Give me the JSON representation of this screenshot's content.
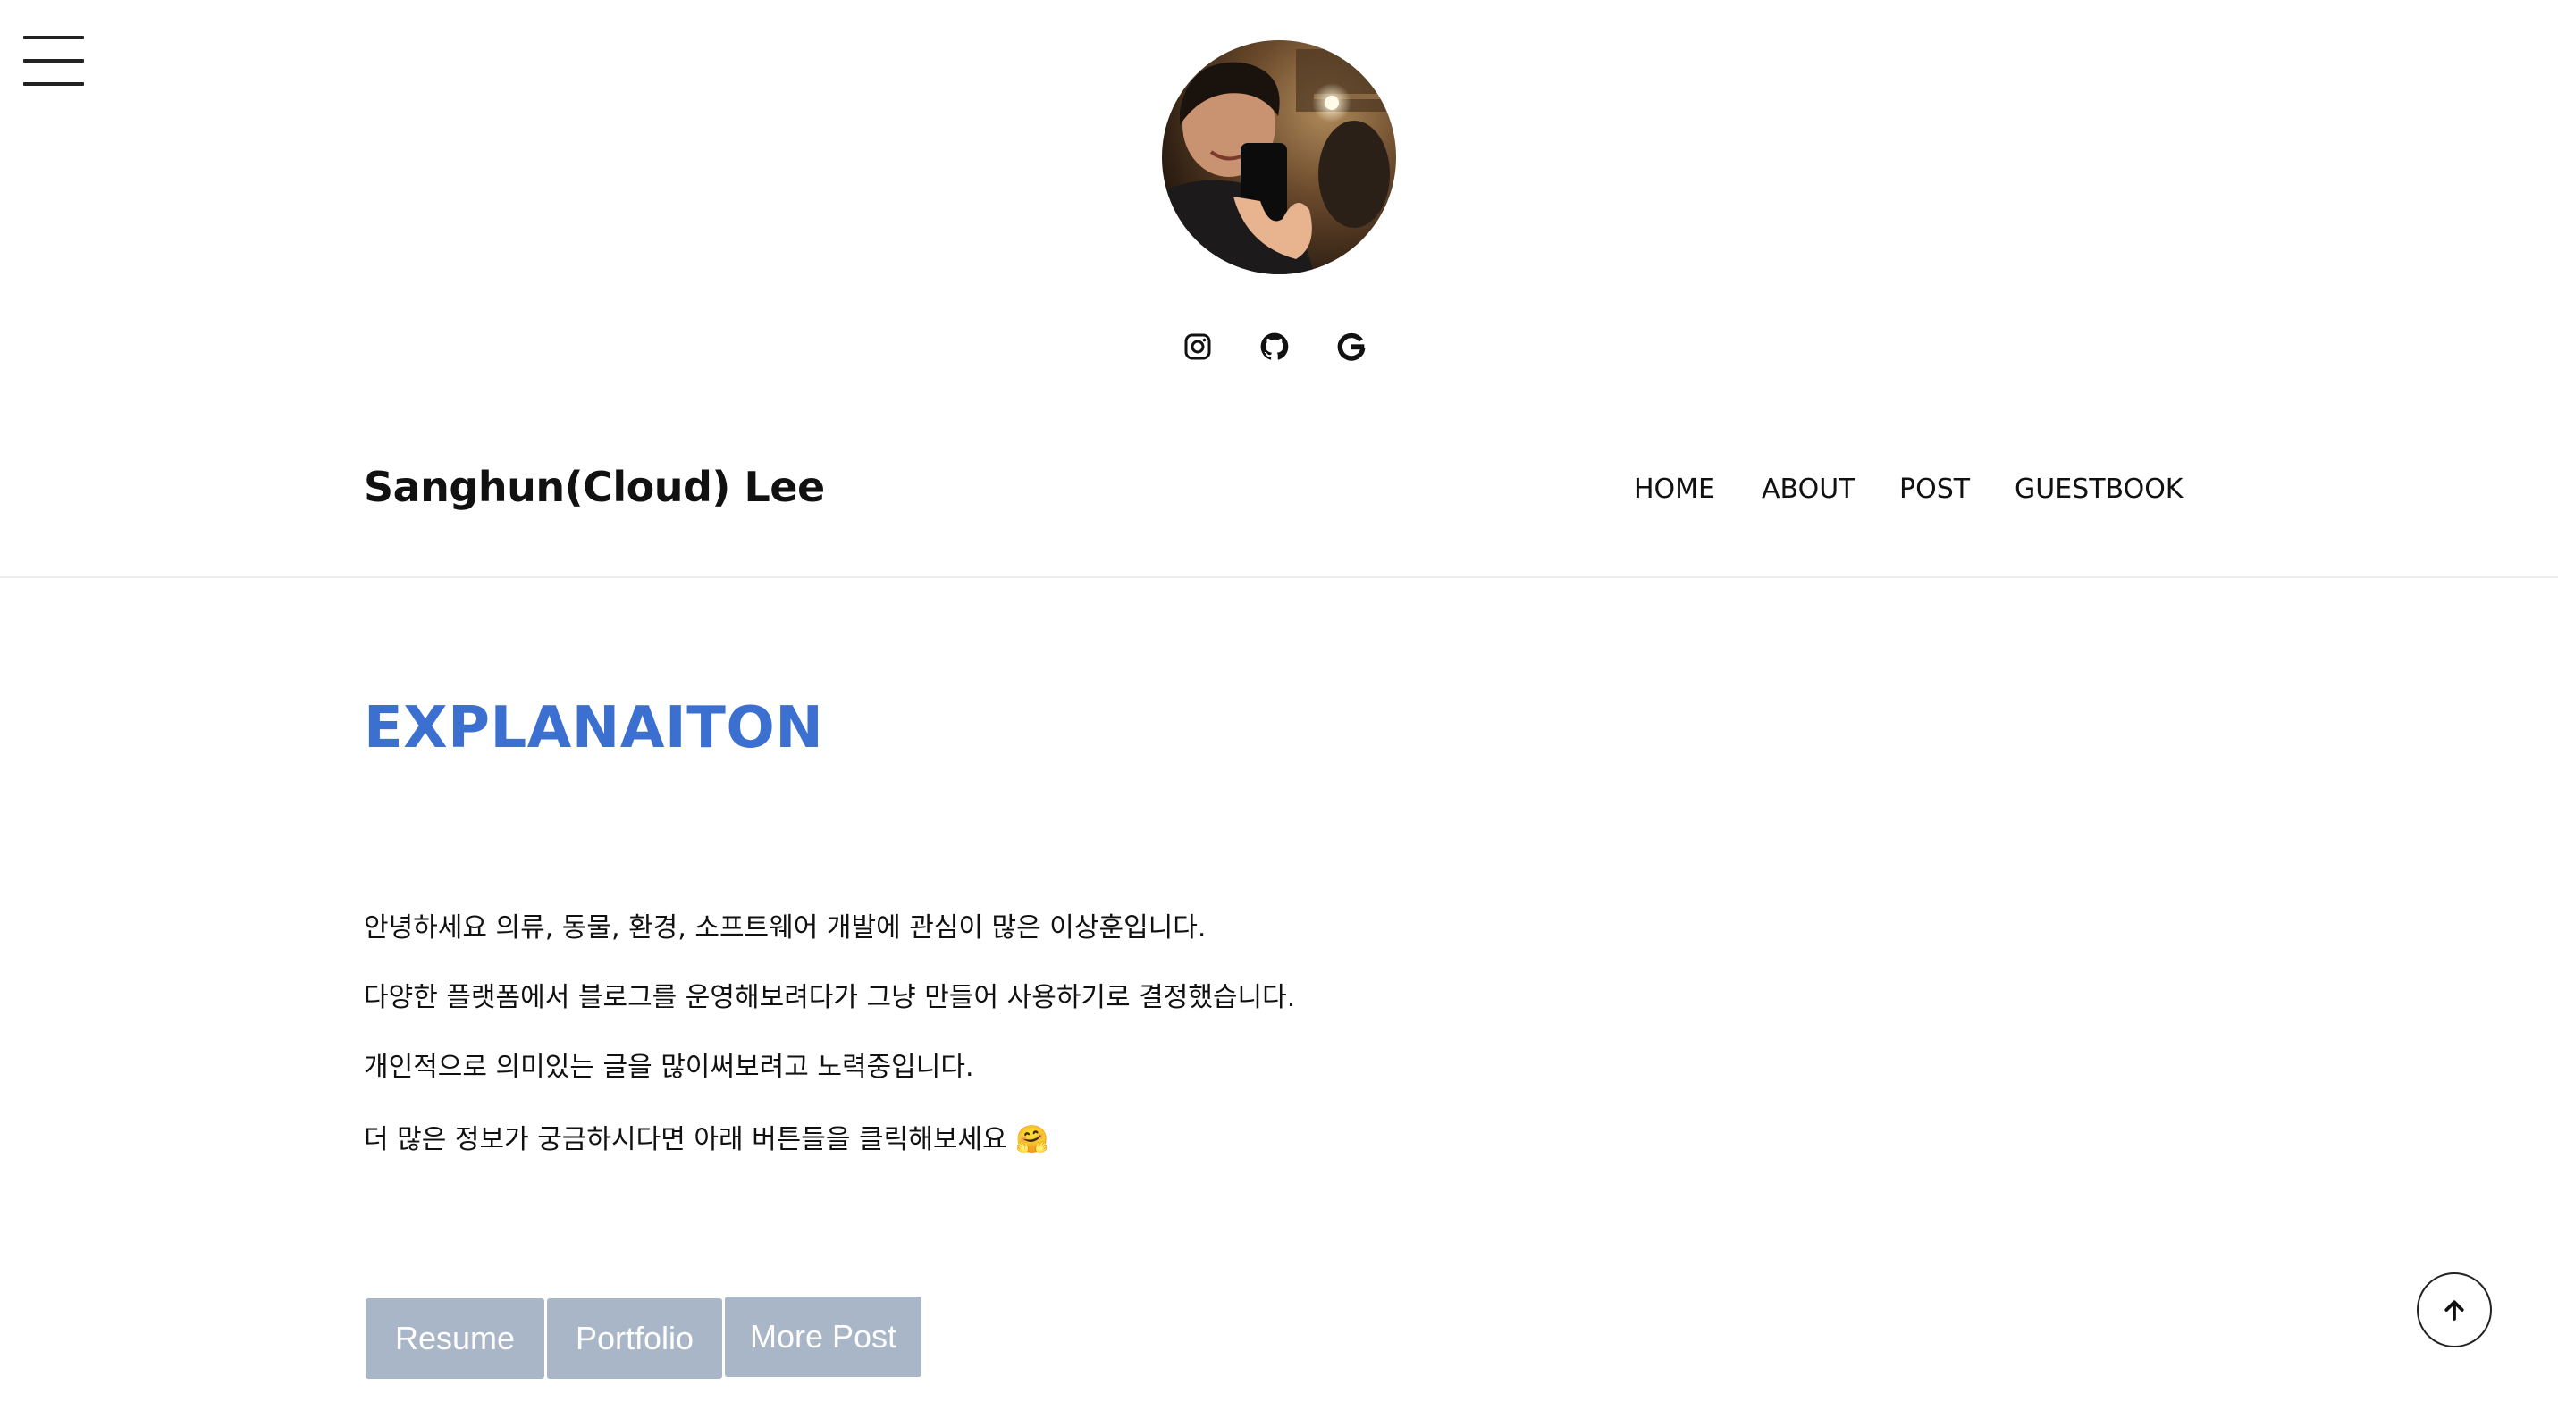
{
  "header": {
    "menu_icon": "hamburger-icon",
    "avatar_alt": "profile-photo",
    "social": [
      {
        "name": "instagram",
        "icon": "instagram-icon"
      },
      {
        "name": "github",
        "icon": "github-icon"
      },
      {
        "name": "google",
        "icon": "google-icon"
      }
    ],
    "site_title": "Sanghun(Cloud) Lee",
    "nav": [
      "HOME",
      "ABOUT",
      "POST",
      "GUESTBOOK"
    ]
  },
  "main": {
    "section_title": "EXPLANAITON",
    "paragraphs": [
      "안녕하세요 의류, 동물, 환경, 소프트웨어 개발에 관심이 많은 이상훈입니다.",
      "다양한 플랫폼에서 블로그를 운영해보려다가 그냥 만들어 사용하기로 결정했습니다.",
      "개인적으로 의미있는 글을 많이써보려고 노력중입니다.",
      "더 많은 정보가 궁금하시다면 아래 버튼들을 클릭해보세요 🤗"
    ],
    "buttons": [
      "Resume",
      "Portfolio",
      "More Post"
    ]
  },
  "scroll_top": {
    "icon": "arrow-up-icon"
  },
  "colors": {
    "accent": "#3b6fd0",
    "button_bg": "#a9b6c8",
    "divider": "#ececec",
    "text": "#111111"
  }
}
